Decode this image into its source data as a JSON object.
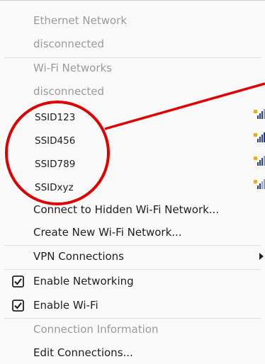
{
  "network_menu": {
    "ethernet_header": "Ethernet Network",
    "ethernet_status": "disconnected",
    "wifi_header": "Wi-Fi Networks",
    "wifi_status": "disconnected",
    "wifi_networks": [
      {
        "ssid": "SSID123",
        "icon": "wifi-signal-locked-icon"
      },
      {
        "ssid": "SSID456",
        "icon": "wifi-signal-locked-icon"
      },
      {
        "ssid": "SSID789",
        "icon": "wifi-signal-locked-icon"
      },
      {
        "ssid": "SSIDxyz",
        "icon": "wifi-signal-locked-icon"
      }
    ],
    "connect_hidden_label": "Connect to Hidden Wi-Fi Network...",
    "create_new_label": "Create New Wi-Fi Network...",
    "vpn_label": "VPN Connections",
    "enable_networking_label": "Enable Networking",
    "enable_networking_checked": true,
    "enable_wifi_label": "Enable Wi-Fi",
    "enable_wifi_checked": true,
    "connection_info_label": "Connection Information",
    "edit_connections_label": "Edit Connections..."
  },
  "colors": {
    "annotation": "#e00000",
    "disabled_text": "#9a9a9a",
    "signal_bar": "#2a3a8a",
    "lock": "#e0b020"
  }
}
